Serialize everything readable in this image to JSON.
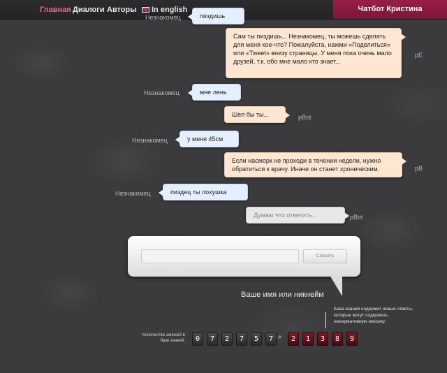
{
  "nav": {
    "home": "Главная",
    "dialogs": "Диалоги",
    "authors": "Авторы",
    "english": "In english",
    "brand": "Чатбот Кристина"
  },
  "labels": {
    "stranger": "Незнакомец",
    "bot": "pBot",
    "bot_short": "pB",
    "bot_partial": "pE"
  },
  "messages": [
    {
      "role": "user",
      "text": "пиздишь"
    },
    {
      "role": "bot",
      "text": "Сам ты пиздишь... Незнакомец, ты можешь сделать для меня кое-что? Пожалуйста, нажми «Поделиться» или «Tweet» внизу страницы. У меня пока очень мало друзей, т.к. обо мне мало кто знает..."
    },
    {
      "role": "user",
      "text": "мне лень"
    },
    {
      "role": "bot",
      "text": "Шел бы ты..."
    },
    {
      "role": "user",
      "text": "у меня 45см"
    },
    {
      "role": "bot",
      "text": "Если насморк не проходи в течении недели, нужно обратиться к врачу. Иначе он станет хроническим."
    },
    {
      "role": "user",
      "text": "пиздец ты лохушка"
    },
    {
      "role": "thinking",
      "text": "Думаю что ответить..."
    }
  ],
  "input": {
    "placeholder": "",
    "send_label": "Сказать",
    "name_label": "Ваше имя или никнейм"
  },
  "counter": {
    "label": "Количество записей в базе знаний:",
    "digits_total": [
      "0",
      "7",
      "2",
      "7",
      "5",
      "7"
    ],
    "plus": "+",
    "digits_new": [
      "2",
      "1",
      "3",
      "8",
      "9"
    ],
    "note": "База знаний содержит новые ответы, которые могут содержать ненормативную лексику."
  },
  "colors": {
    "brand": "#8a1a42",
    "active_nav": "#e66d8c",
    "user_bubble": "#e4efff",
    "bot_bubble": "#fde7d2"
  }
}
